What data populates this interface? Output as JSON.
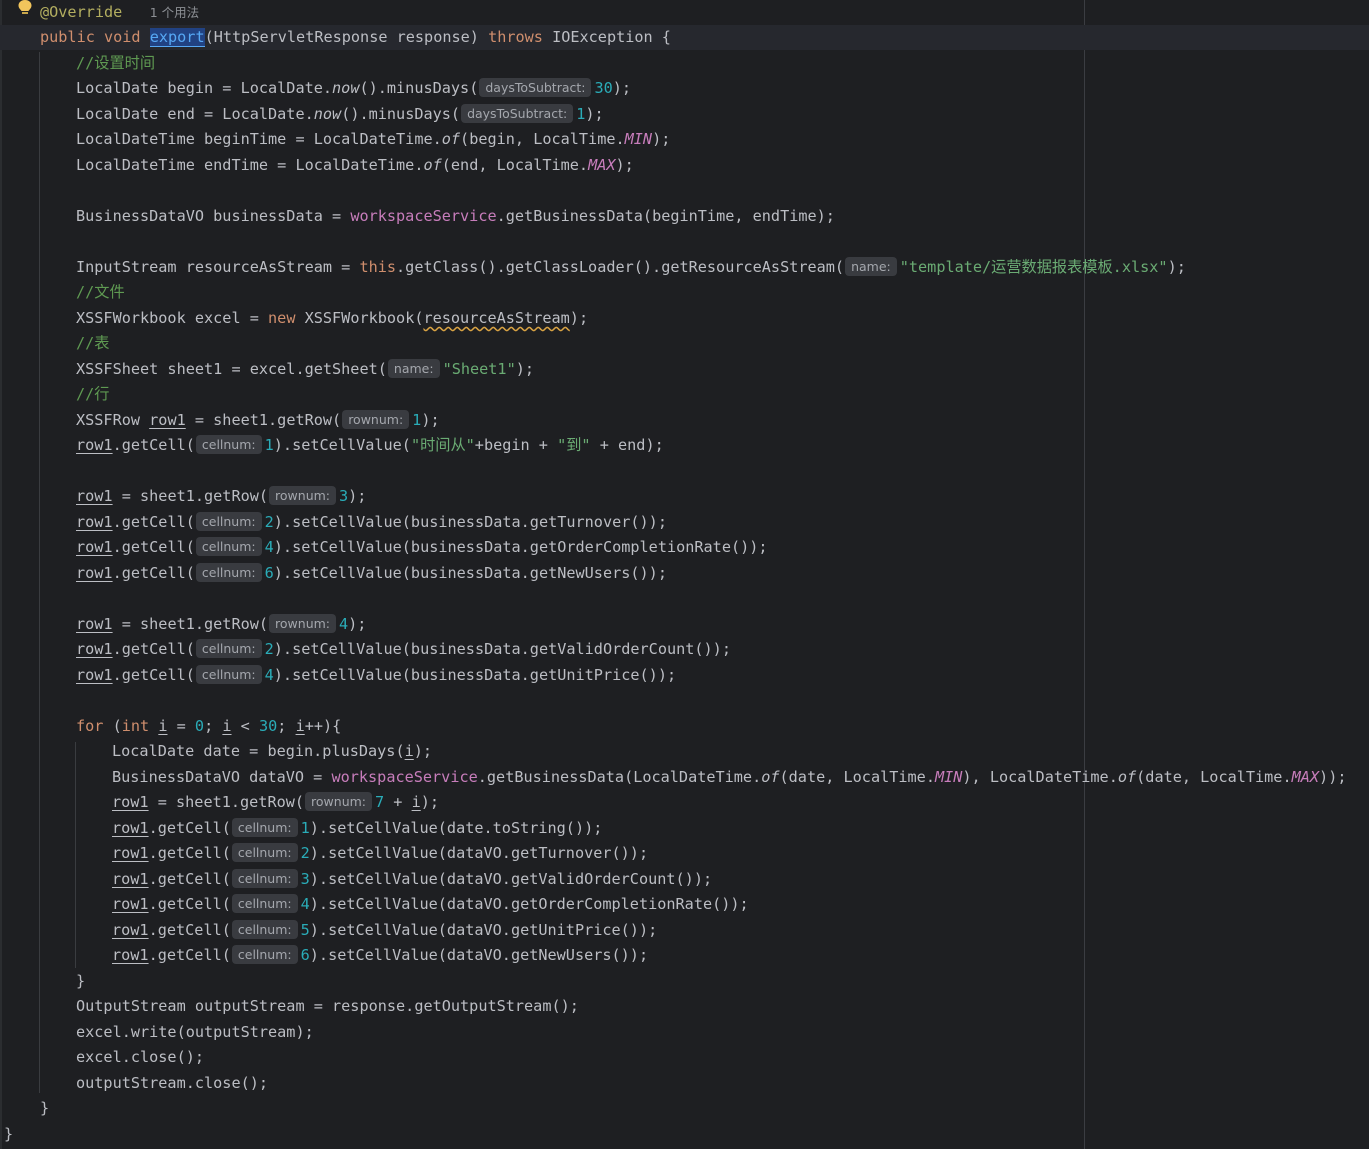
{
  "editor": {
    "usage_hint": "1 个用法",
    "hint_labels": {
      "days": "daysToSubtract:",
      "name": "name:",
      "rownum": "rownum:",
      "cellnum": "cellnum:"
    },
    "strings": {
      "template": "\"template/运营数据报表模板.xlsx\"",
      "sheet": "\"Sheet1\"",
      "from": "\"时间从\"",
      "to": "\"到\""
    },
    "comments": {
      "set_time": "//设置时间",
      "file": "//文件",
      "table": "//表",
      "row": "//行"
    },
    "numbers": [
      "30",
      "1",
      "3",
      "2",
      "4",
      "6",
      "0",
      "7",
      "5"
    ]
  },
  "colors": {
    "background": "#1e1f22",
    "current_line": "#26282e",
    "text": "#bcbec4",
    "keyword": "#cf8e6d",
    "annotation": "#b3ae60",
    "number": "#2aacb8",
    "string": "#6aab73",
    "comment": "#5f9a52",
    "field": "#c77dbb",
    "method_declaration": "#56a8f5"
  },
  "icons": [
    "intention-bulb-icon"
  ]
}
